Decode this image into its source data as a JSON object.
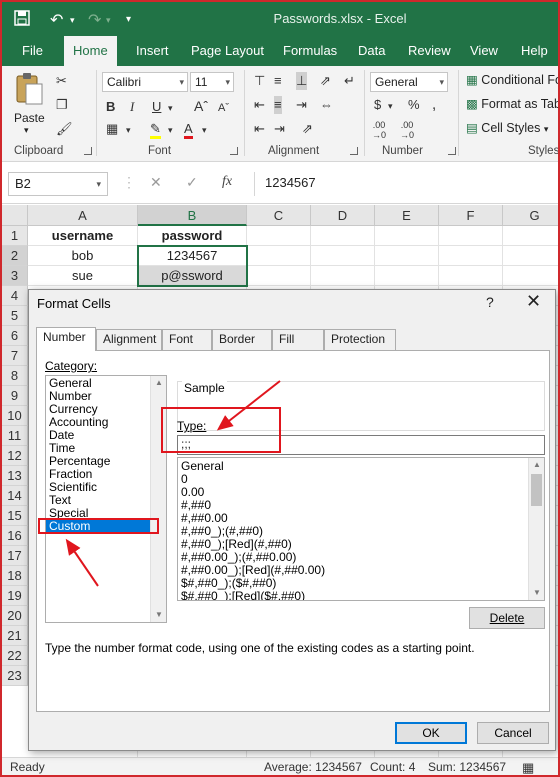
{
  "app": {
    "title": "Passwords.xlsx  -  Excel",
    "quick_access": [
      "save-icon",
      "undo-icon",
      "redo-icon",
      "customize-icon"
    ]
  },
  "ribbon": {
    "tabs": [
      "File",
      "Home",
      "Insert",
      "Page Layout",
      "Formulas",
      "Data",
      "Review",
      "View",
      "Help"
    ],
    "active_tab": "Home",
    "clipboard": {
      "paste_label": "Paste",
      "group_label": "Clipboard"
    },
    "font": {
      "name": "Calibri",
      "size": "11",
      "group_label": "Font"
    },
    "alignment": {
      "group_label": "Alignment"
    },
    "number": {
      "format": "General",
      "group_label": "Number"
    },
    "styles": {
      "conditional": "Conditional Fo",
      "format_table": "Format as Tab",
      "cell_styles": "Cell Styles",
      "group_label": "Styles"
    }
  },
  "formula_bar": {
    "name_box": "B2",
    "fx": "fx",
    "value": "1234567"
  },
  "grid": {
    "columns": [
      "A",
      "B",
      "C",
      "D",
      "E",
      "F",
      "G"
    ],
    "rows": [
      "1",
      "2",
      "3",
      "4",
      "5",
      "6",
      "7",
      "8",
      "9",
      "10",
      "11",
      "12",
      "13",
      "14",
      "15",
      "16",
      "17",
      "18",
      "19",
      "20",
      "21",
      "22",
      "23"
    ],
    "cells": {
      "A1": "username",
      "B1": "password",
      "A2": "bob",
      "B2": "1234567",
      "A3": "sue",
      "B3": "p@ssword"
    }
  },
  "status": {
    "ready": "Ready",
    "average": "Average: 1234567",
    "count": "Count: 4",
    "sum": "Sum: 1234567"
  },
  "dialog": {
    "title": "Format Cells",
    "help": "?",
    "close": "✕",
    "tabs": [
      "Number",
      "Alignment",
      "Font",
      "Border",
      "Fill",
      "Protection"
    ],
    "active_tab": "Number",
    "category_label": "Category:",
    "categories": [
      "General",
      "Number",
      "Currency",
      "Accounting",
      "Date",
      "Time",
      "Percentage",
      "Fraction",
      "Scientific",
      "Text",
      "Special",
      "Custom"
    ],
    "selected_category": "Custom",
    "sample_label": "Sample",
    "type_label": "Type:",
    "type_value": ";;;",
    "formats": [
      "General",
      "0",
      "0.00",
      "#,##0",
      "#,##0.00",
      "#,##0_);(#,##0)",
      "#,##0_);[Red](#,##0)",
      "#,##0.00_);(#,##0.00)",
      "#,##0.00_);[Red](#,##0.00)",
      "$#,##0_);($#,##0)",
      "$#,##0_);[Red]($#,##0)"
    ],
    "delete_label": "Delete",
    "hint": "Type the number format code, using one of the existing codes as a starting point.",
    "ok_label": "OK",
    "cancel_label": "Cancel"
  },
  "colors": {
    "excel_green": "#217346",
    "annotation_red": "#e0161e",
    "selection_blue": "#0078d7"
  }
}
